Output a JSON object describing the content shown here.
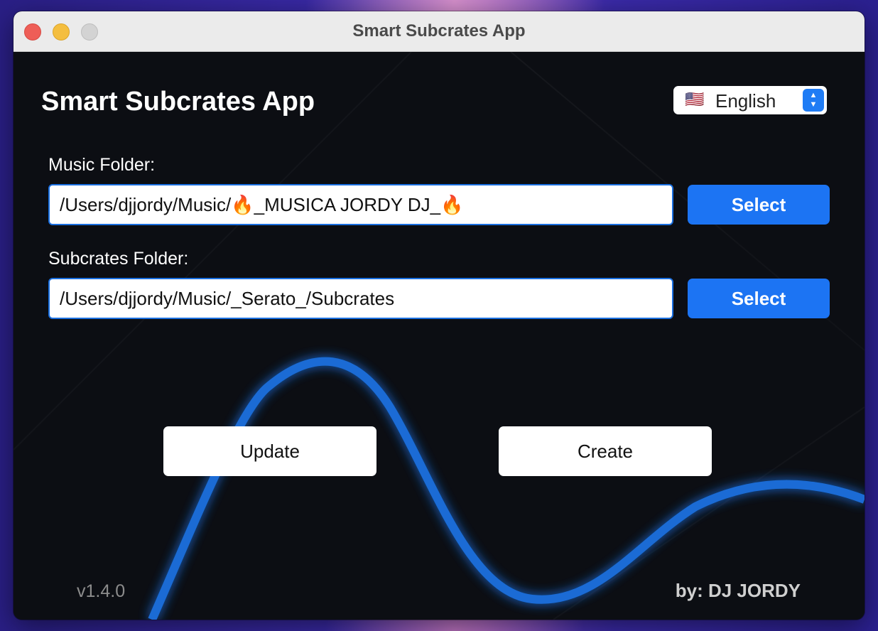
{
  "window": {
    "title": "Smart Subcrates App"
  },
  "app": {
    "heading": "Smart Subcrates App",
    "version": "v1.4.0",
    "author": "by: DJ JORDY"
  },
  "language": {
    "flag": "🇺🇸",
    "selected": "English"
  },
  "music_folder": {
    "label": "Music Folder:",
    "value": "/Users/djjordy/Music/🔥_MUSICA JORDY DJ_🔥",
    "button": "Select"
  },
  "subcrates_folder": {
    "label": "Subcrates Folder:",
    "value": "/Users/djjordy/Music/_Serato_/Subcrates",
    "button": "Select"
  },
  "actions": {
    "update": "Update",
    "create": "Create"
  },
  "colors": {
    "accent": "#1c74f3",
    "background": "#0c0e13",
    "wave": "#1a6fe0"
  },
  "icons": {
    "language_stepper": "chevron-up-down-icon"
  }
}
